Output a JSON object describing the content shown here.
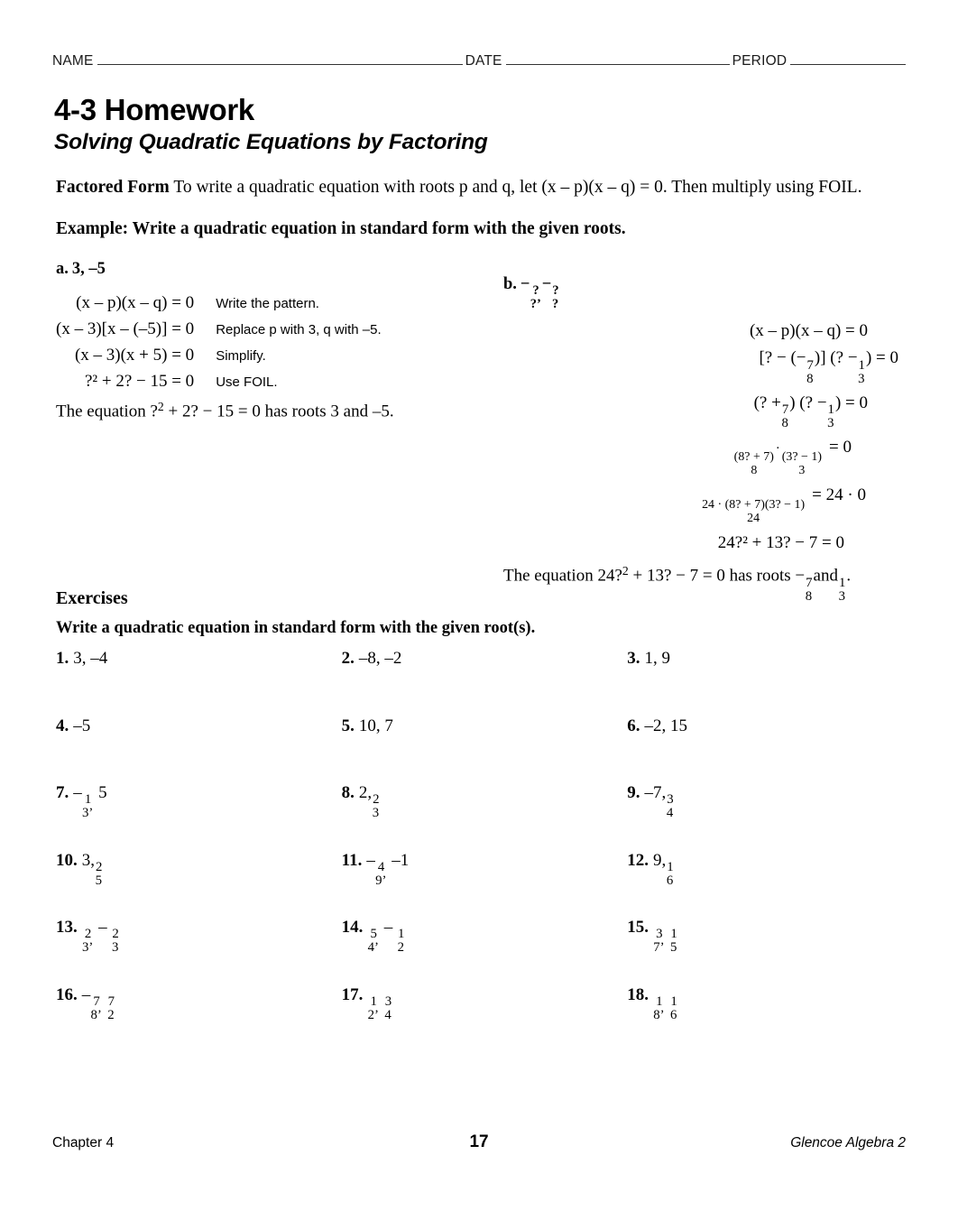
{
  "header": {
    "name_label": "NAME",
    "date_label": "DATE",
    "period_label": "PERIOD"
  },
  "title": "4-3 Homework",
  "subtitle": "Solving Quadratic Equations by Factoring",
  "concept": {
    "heading": "Factored Form",
    "text": " To write a quadratic equation with roots p and q, let (x – p)(x – q) = 0. Then multiply using FOIL."
  },
  "example_heading": "Example: Write a quadratic equation in standard form with the given roots.",
  "example_a": {
    "label": "a.",
    "roots": "3, –5",
    "steps": [
      {
        "equation": "(x – p)(x – q) = 0",
        "note": "Write the pattern."
      },
      {
        "equation": "(x – 3)[x – (–5)] = 0",
        "note": "Replace p with 3, q with –5."
      },
      {
        "equation": "(x – 3)(x + 5) = 0",
        "note": "Simplify."
      },
      {
        "equation": "?² + 2? − 15  = 0",
        "note": "Use FOIL."
      }
    ],
    "conclusion_pre": "The equation ?",
    "conclusion_sup": "2",
    "conclusion_post": " + 2? − 15   = 0 has roots 3 and –5."
  },
  "example_b": {
    "label": "b.",
    "roots_prefix": "−",
    "root1_num": "?",
    "root1_den": "?",
    "roots_sep": ",",
    "root2_prefix": "−",
    "root2_num": "?",
    "root2_den": "?",
    "line1": "(x – p)(x – q) = 0",
    "line2": {
      "a": "[? − (−",
      "f1n": "7",
      "f1d": "8",
      "b": ")] (? −",
      "f2n": "1",
      "f2d": "3",
      "c": ") = 0"
    },
    "line3": {
      "a": "(? +",
      "f1n": "7",
      "f1d": "8",
      "b": ") (? −",
      "f2n": "1",
      "f2d": "3",
      "c": ") = 0"
    },
    "line4": {
      "f1n": "(8? + 7)",
      "f1d": "8",
      "dot": "·",
      "f2n": "(3? − 1)",
      "f2d": "3",
      "tail": "= 0"
    },
    "line5": {
      "fn": "24 · (8? + 7)(3? − 1)",
      "fd": "24",
      "tail": "= 24 · 0"
    },
    "line6": "24?² + 13? − 7  = 0",
    "conclusion_pre": "The equation 24?",
    "conclusion_sup": "2",
    "conclusion_mid": " + 13? − 7   = 0 has roots −",
    "concl_f1n": "7",
    "concl_f1d": "8",
    "conclusion_and": "and",
    "concl_f2n": "1",
    "concl_f2d": "3",
    "conclusion_end": "."
  },
  "exercises": {
    "heading": "Exercises",
    "directions": "Write a quadratic equation in standard form with the given root(s).",
    "items": [
      {
        "n": "1.",
        "plain": "3, –4"
      },
      {
        "n": "2.",
        "plain": "–8, –2"
      },
      {
        "n": "3.",
        "plain": "1, 9"
      },
      {
        "n": "4.",
        "plain": "–5"
      },
      {
        "n": "5.",
        "plain": "10, 7"
      },
      {
        "n": "6.",
        "plain": "–2, 15"
      },
      {
        "n": "7.",
        "pre": "–",
        "f1n": "1",
        "f1d": "3",
        "f1comma": true,
        "post": " 5"
      },
      {
        "n": "8.",
        "pre": "2,",
        "f1n": "2",
        "f1d": "3"
      },
      {
        "n": "9.",
        "pre": "–7,",
        "f1n": "3",
        "f1d": "4"
      },
      {
        "n": "10.",
        "pre": "3,",
        "f1n": "2",
        "f1d": "5"
      },
      {
        "n": "11.",
        "pre": "–",
        "f1n": "4",
        "f1d": "9",
        "f1comma": true,
        "post": " –1"
      },
      {
        "n": "12.",
        "pre": "9,",
        "f1n": "1",
        "f1d": "6"
      },
      {
        "n": "13.",
        "f1n": "2",
        "f1d": "3",
        "f1comma": true,
        "mid": " – ",
        "f2n": "2",
        "f2d": "3"
      },
      {
        "n": "14.",
        "f1n": "5",
        "f1d": "4",
        "f1comma": true,
        "mid": " – ",
        "f2n": "1",
        "f2d": "2"
      },
      {
        "n": "15.",
        "f1n": "3",
        "f1d": "7",
        "f1comma": true,
        "mid": " ",
        "f2n": "1",
        "f2d": "5"
      },
      {
        "n": "16.",
        "pre": "–",
        "f1n": "7",
        "f1d": "8",
        "f1comma": true,
        "mid": " ",
        "f2n": "7",
        "f2d": "2"
      },
      {
        "n": "17.",
        "f1n": "1",
        "f1d": "2",
        "f1comma": true,
        "mid": " ",
        "f2n": "3",
        "f2d": "4"
      },
      {
        "n": "18.",
        "f1n": "1",
        "f1d": "8",
        "f1comma": true,
        "mid": " ",
        "f2n": "1",
        "f2d": "6"
      }
    ]
  },
  "footer": {
    "chapter": "Chapter 4",
    "page": "17",
    "book": "Glencoe Algebra 2"
  }
}
